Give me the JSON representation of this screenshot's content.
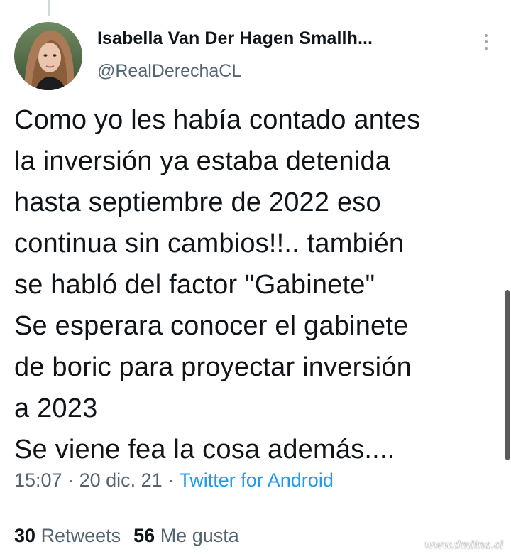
{
  "tweet": {
    "author": {
      "name": "Isabella Van Der Hagen Smallh...",
      "handle": "@RealDerechaCL"
    },
    "text": "Como yo les había contado antes\nla inversión ya estaba detenida\nhasta septiembre de 2022  eso\ncontinua sin cambios!!.. también\nse habló del factor \"Gabinete\"\nSe esperara conocer el gabinete\nde boric para proyectar inversión\na 2023\nSe viene fea la cosa además....",
    "time": "15:07",
    "date": "20 dic. 21",
    "separator": "·",
    "source": "Twitter for Android",
    "stats": {
      "retweets_count": "30",
      "retweets_label": "Retweets",
      "likes_count": "56",
      "likes_label": "Me gusta"
    }
  },
  "icons": {
    "more_menu": "vertical-dots-icon"
  },
  "watermark": "www.dmlina.cl",
  "colors": {
    "text_primary": "#0f1419",
    "text_secondary": "#536471",
    "link": "#1d9bf0",
    "divider": "#eff3f4"
  }
}
